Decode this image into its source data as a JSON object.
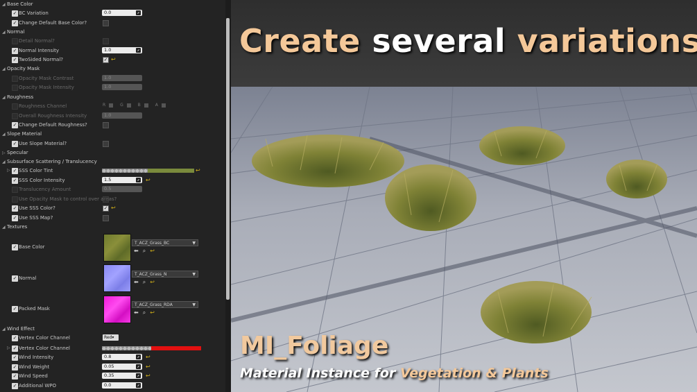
{
  "panel": {
    "sections": {
      "base_color": "Base Color",
      "normal": "Normal",
      "opacity_mask": "Opacity Mask",
      "roughness": "Roughness",
      "slope_material": "Slope Material",
      "specular": "Specular",
      "sss": "Subsurface Scattering / Translucency",
      "textures": "Textures",
      "wind": "Wind Effect"
    },
    "params": {
      "bc_variation": {
        "label": "BC Variation",
        "value": "0.0"
      },
      "change_default_bc": {
        "label": "Change Default Base Color?"
      },
      "detail_normal": {
        "label": "Detail Normal?"
      },
      "normal_intensity": {
        "label": "Normal Intensity",
        "value": "1.0"
      },
      "twosided_normal": {
        "label": "TwoSided Normal?"
      },
      "opacity_mask_contrast": {
        "label": "Opacity Mask Contrast",
        "value": "1.0"
      },
      "opacity_mask_intensity": {
        "label": "Opacity Mask Intensity",
        "value": "1.0"
      },
      "roughness_channel": {
        "label": "Roughness Channel"
      },
      "overall_roughness": {
        "label": "Overall Roughness Intensity",
        "value": "1.0"
      },
      "change_default_roughness": {
        "label": "Change Default Roughness?"
      },
      "use_slope": {
        "label": "Use Slope Material?"
      },
      "sss_tint": {
        "label": "SSS Color Tint"
      },
      "sss_intensity": {
        "label": "SSS Color Intensity",
        "value": "1.5"
      },
      "translucency": {
        "label": "Translucency Amount",
        "value": "0.5"
      },
      "use_opacity_mask_ctrl": {
        "label": "Use Opacity Mask to control over areas?"
      },
      "use_sss_color": {
        "label": "Use SSS Color?"
      },
      "use_sss_map": {
        "label": "Use SSS Map?"
      },
      "tex_base_color": {
        "label": "Base Color",
        "asset": "T_ACZ_Grass_BC"
      },
      "tex_normal": {
        "label": "Normal",
        "asset": "T_ACZ_Grass_N"
      },
      "tex_packed": {
        "label": "Packed Mask",
        "asset": "T_ACZ_Grass_RDA"
      },
      "vertex_color_channel": {
        "label": "Vertex Color Channel",
        "value": "Red"
      },
      "vertex_color_channel2": {
        "label": "Vertex Color Channel"
      },
      "wind_intensity": {
        "label": "Wind Intensity",
        "value": "0.8"
      },
      "wind_weight": {
        "label": "Wind Weight",
        "value": "0.05"
      },
      "wind_speed": {
        "label": "Wind Speed",
        "value": "0.35"
      },
      "additional_wpo": {
        "label": "Additional WPO",
        "value": "0.0"
      }
    },
    "rgba_labels": [
      "R",
      "G",
      "B",
      "A"
    ],
    "colors": {
      "sss_tint": "#7a8a3c",
      "vertex_color": "#e21010",
      "reset": "#d4b21a"
    }
  },
  "render": {
    "headline": {
      "w1": "Create",
      "w2": " several ",
      "w3": "variations..."
    },
    "title": "MI_Foliage",
    "subtitle": {
      "pre": "Material Instance for ",
      "highlight": "Vegetation & Plants"
    }
  }
}
